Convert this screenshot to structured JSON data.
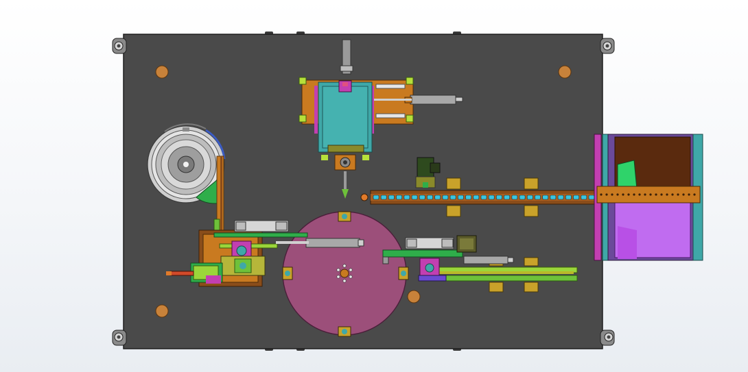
{
  "viewport": {
    "background": "#f4f6f9"
  },
  "colors": {
    "base_plate": "#4a4a4a",
    "base_plate_edge": "#1e1e1e",
    "bolt_hole": "#c8823a",
    "rotary_table": "#9c4f7a",
    "magenta_part": "#c23fb1",
    "teal_part": "#3fa8a8",
    "olive_part": "#8a8a2a",
    "brown_part": "#8a4d1a",
    "orange_part": "#c97a20",
    "green_part": "#6ec13a",
    "lime_part": "#9bd63a",
    "violet_part": "#c06cf0",
    "cylinder_grey": "#9a9a9a",
    "cylinder_red": "#d24a2a",
    "cyan_bead": "#39c5e0",
    "dark_green_valve": "#2e4a1e"
  },
  "components": {
    "base_plate": {
      "name": "base-plate"
    },
    "vibratory_bowl": {
      "name": "vibratory-bowl-feeder"
    },
    "top_station": {
      "name": "top-pick-place-station"
    },
    "linear_feeder": {
      "name": "linear-feeder-track",
      "bead_count": 29
    },
    "bin": {
      "name": "output-bin"
    },
    "rotary_table": {
      "name": "rotary-index-table"
    },
    "left_station": {
      "name": "left-insertion-station"
    },
    "right_station": {
      "name": "right-press-station"
    }
  }
}
